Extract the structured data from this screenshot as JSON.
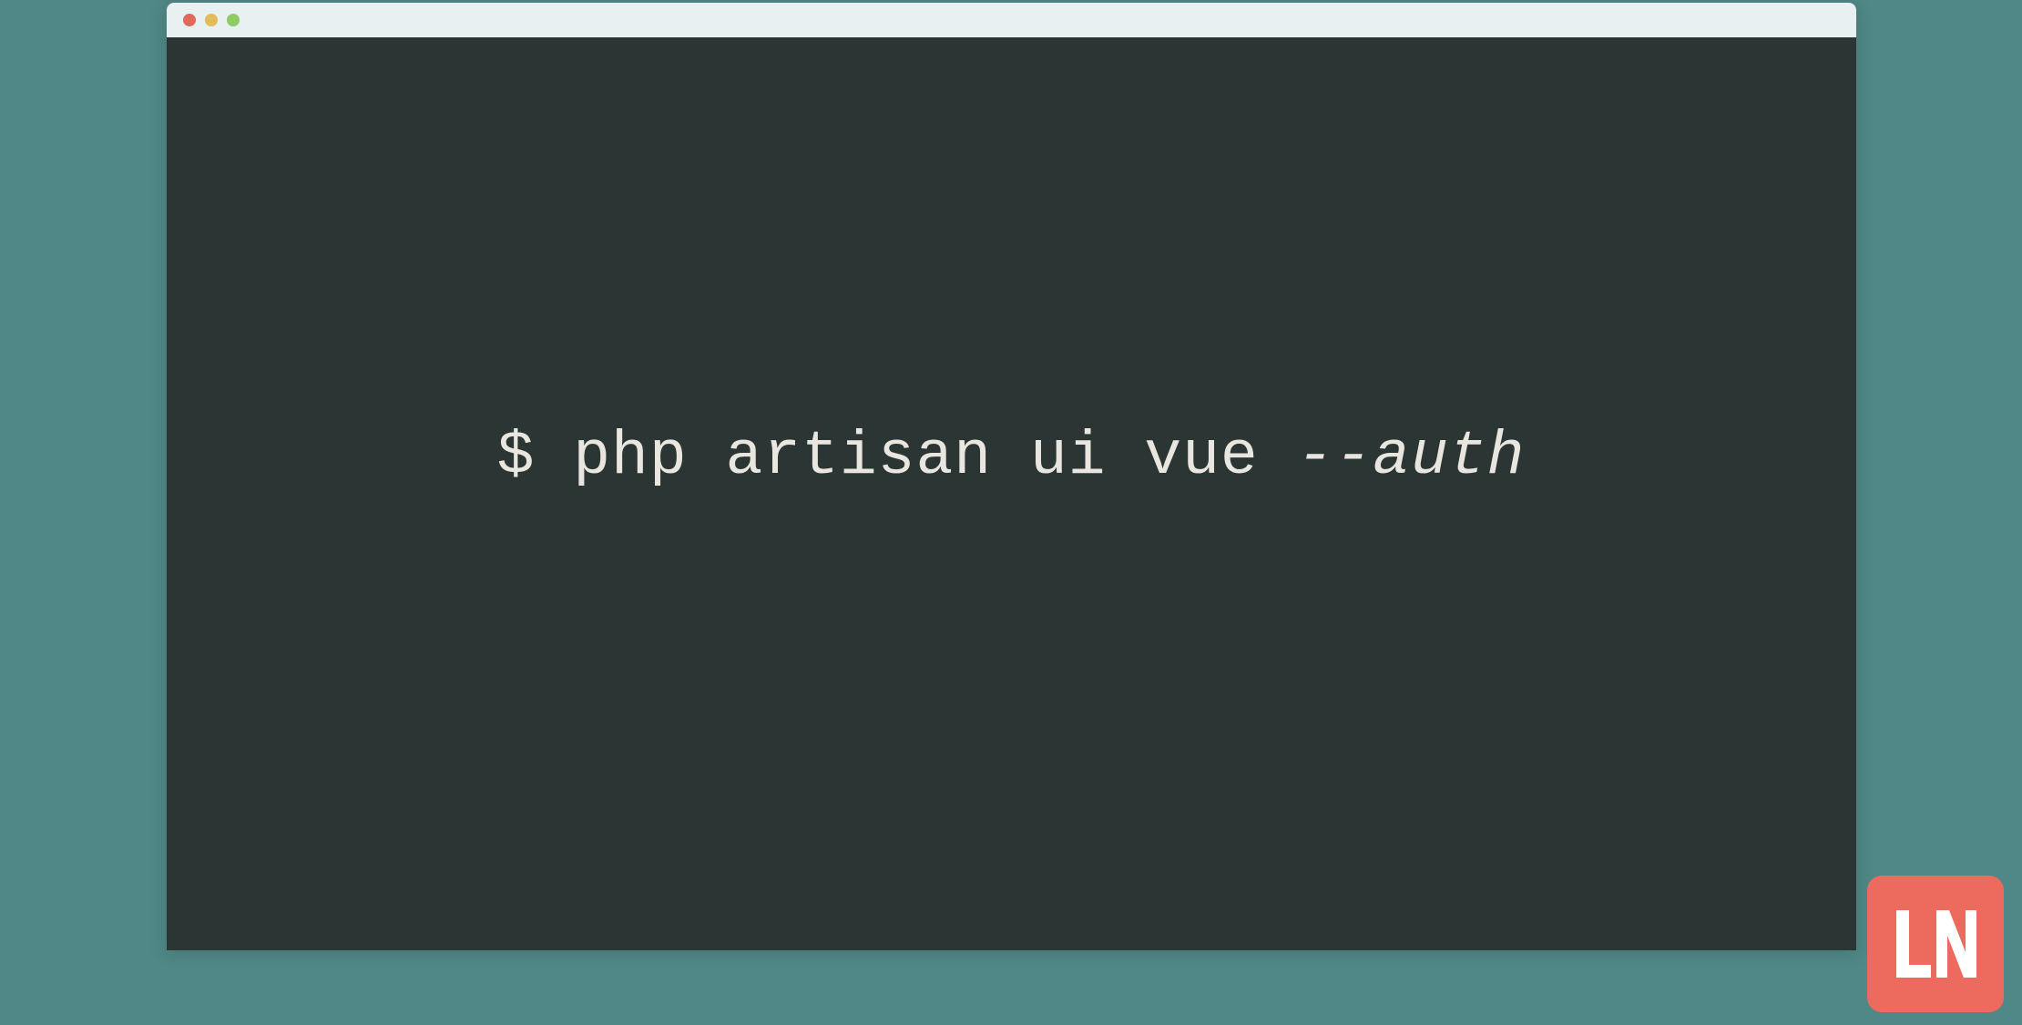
{
  "terminal": {
    "prompt": "$ ",
    "command": "php artisan ui vue ",
    "flag": "--auth"
  },
  "logo": {
    "text": "LN"
  },
  "colors": {
    "background": "#4f8886",
    "terminal_bg": "#2a3534",
    "title_bar": "#e8f0f2",
    "text": "#e8e6df",
    "traffic_red": "#e0695c",
    "traffic_yellow": "#e2bb5b",
    "traffic_green": "#8dcb63",
    "logo_bg": "#ed6a5e"
  }
}
